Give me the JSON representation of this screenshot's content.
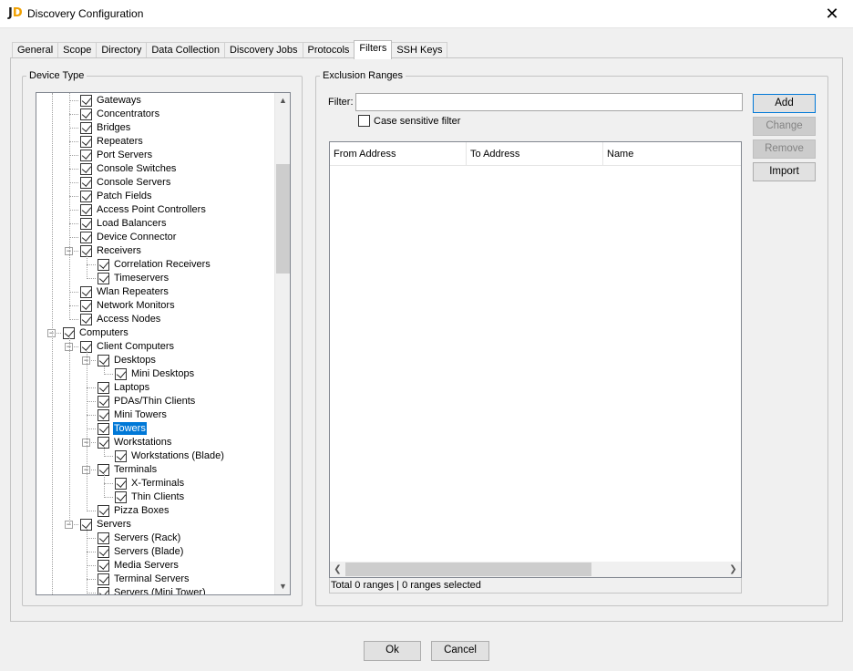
{
  "window": {
    "title": "Discovery Configuration",
    "close_glyph": "✕",
    "icon": "discovery-app-icon"
  },
  "tabs": [
    "General",
    "Scope",
    "Directory",
    "Data Collection",
    "Discovery Jobs",
    "Protocols",
    "Filters",
    "SSH Keys"
  ],
  "active_tab": "Filters",
  "device_type": {
    "title": "Device Type",
    "tree": [
      {
        "label": "Gateways",
        "level": 2,
        "checked": true
      },
      {
        "label": "Concentrators",
        "level": 2,
        "checked": true
      },
      {
        "label": "Bridges",
        "level": 2,
        "checked": true
      },
      {
        "label": "Repeaters",
        "level": 2,
        "checked": true
      },
      {
        "label": "Port Servers",
        "level": 2,
        "checked": true
      },
      {
        "label": "Console Switches",
        "level": 2,
        "checked": true
      },
      {
        "label": "Console Servers",
        "level": 2,
        "checked": true
      },
      {
        "label": "Patch Fields",
        "level": 2,
        "checked": true
      },
      {
        "label": "Access Point Controllers",
        "level": 2,
        "checked": true
      },
      {
        "label": "Load Balancers",
        "level": 2,
        "checked": true
      },
      {
        "label": "Device Connector",
        "level": 2,
        "checked": true
      },
      {
        "label": "Receivers",
        "level": 2,
        "checked": true,
        "expanded": true
      },
      {
        "label": "Correlation Receivers",
        "level": 3,
        "checked": true
      },
      {
        "label": "Timeservers",
        "level": 3,
        "checked": true
      },
      {
        "label": "Wlan Repeaters",
        "level": 2,
        "checked": true
      },
      {
        "label": "Network Monitors",
        "level": 2,
        "checked": true
      },
      {
        "label": "Access Nodes",
        "level": 2,
        "checked": true
      },
      {
        "label": "Computers",
        "level": 1,
        "checked": true,
        "expanded": true
      },
      {
        "label": "Client Computers",
        "level": 2,
        "checked": true,
        "expanded": true
      },
      {
        "label": "Desktops",
        "level": 3,
        "checked": true,
        "expanded": true
      },
      {
        "label": "Mini Desktops",
        "level": 4,
        "checked": true
      },
      {
        "label": "Laptops",
        "level": 3,
        "checked": true
      },
      {
        "label": "PDAs/Thin Clients",
        "level": 3,
        "checked": true
      },
      {
        "label": "Mini Towers",
        "level": 3,
        "checked": true
      },
      {
        "label": "Towers",
        "level": 3,
        "checked": true,
        "selected": true
      },
      {
        "label": "Workstations",
        "level": 3,
        "checked": true,
        "expanded": true
      },
      {
        "label": "Workstations (Blade)",
        "level": 4,
        "checked": true
      },
      {
        "label": "Terminals",
        "level": 3,
        "checked": true,
        "expanded": true
      },
      {
        "label": "X-Terminals",
        "level": 4,
        "checked": true
      },
      {
        "label": "Thin Clients",
        "level": 4,
        "checked": true
      },
      {
        "label": "Pizza Boxes",
        "level": 3,
        "checked": true
      },
      {
        "label": "Servers",
        "level": 2,
        "checked": true,
        "expanded": true
      },
      {
        "label": "Servers (Rack)",
        "level": 3,
        "checked": true
      },
      {
        "label": "Servers (Blade)",
        "level": 3,
        "checked": true
      },
      {
        "label": "Media Servers",
        "level": 3,
        "checked": true
      },
      {
        "label": "Terminal Servers",
        "level": 3,
        "checked": true
      },
      {
        "label": "Servers (Mini Tower)",
        "level": 3,
        "checked": true
      }
    ]
  },
  "exclusion": {
    "title": "Exclusion Ranges",
    "filter_label": "Filter:",
    "filter_value": "",
    "case_label": "Case sensitive filter",
    "case_checked": false,
    "buttons": {
      "add": "Add",
      "change": "Change",
      "remove": "Remove",
      "import": "Import"
    },
    "columns": [
      "From Address",
      "To Address",
      "Name"
    ],
    "status": "Total 0 ranges | 0 ranges selected"
  },
  "footer": {
    "ok": "Ok",
    "cancel": "Cancel"
  }
}
